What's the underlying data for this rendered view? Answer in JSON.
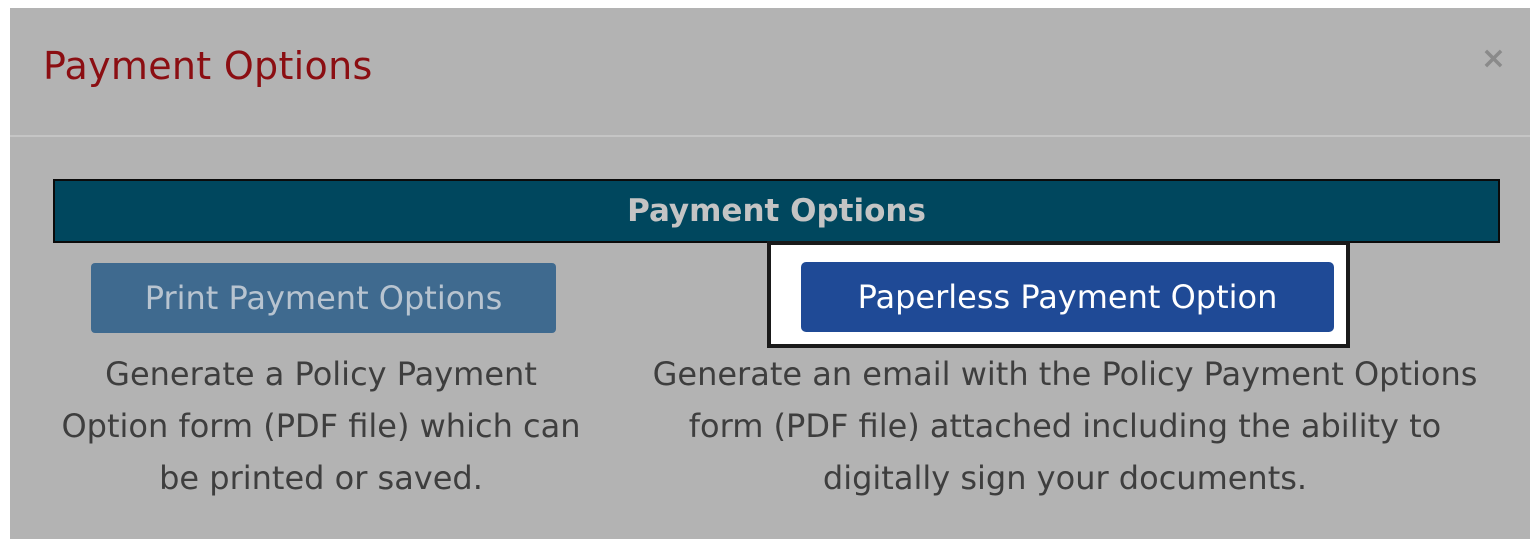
{
  "modal": {
    "title": "Payment Options",
    "close_label": "×"
  },
  "section": {
    "header": "Payment Options"
  },
  "options": {
    "print": {
      "button_label": "Print Payment Options",
      "description": "Generate a Policy Payment Option form (PDF file) which can be printed or saved."
    },
    "paperless": {
      "button_label": "Paperless Payment Option",
      "description": "Generate an email with the Policy Payment Options form (PDF file) attached including the ability to digitally sign your documents."
    }
  },
  "colors": {
    "overlay_gray": "#b3b3b3",
    "title_red": "#8b0e12",
    "section_bar_teal": "#00475e",
    "print_button_blue": "#3f6a8f",
    "paperless_button_blue": "#1f4a96"
  }
}
